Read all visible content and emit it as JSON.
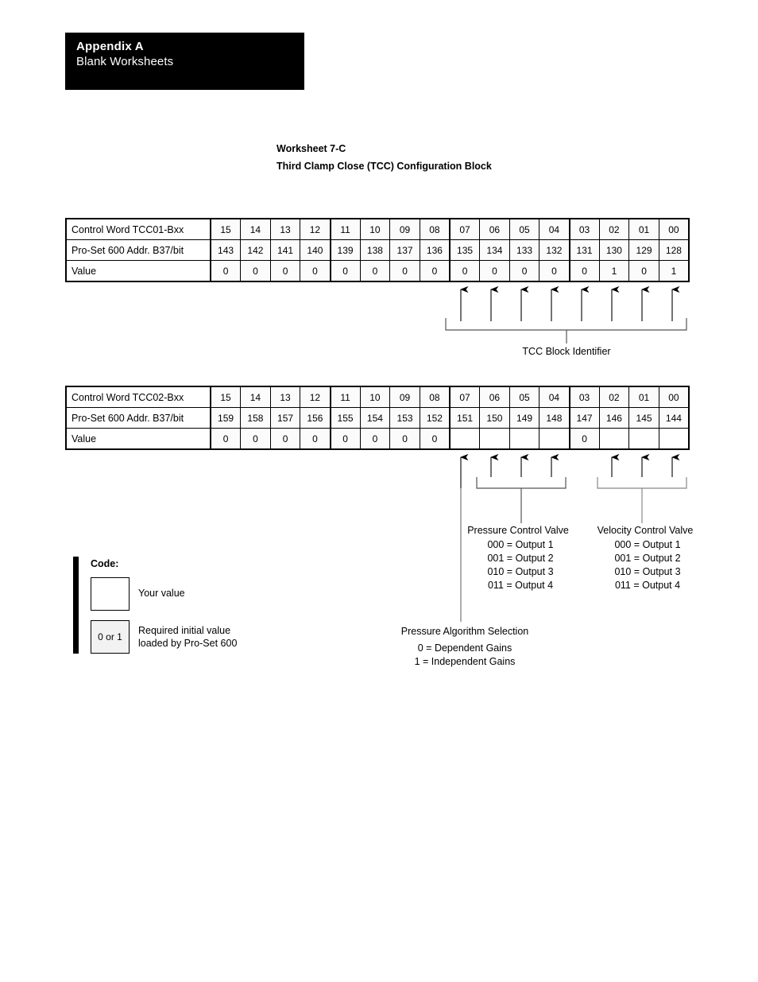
{
  "header": {
    "appendix_title": "Appendix A",
    "appendix_subtitle": "Blank Worksheets"
  },
  "worksheet": {
    "number_label": "Worksheet 7-C",
    "title": "Third Clamp Close (TCC) Configuration Block"
  },
  "tables": [
    {
      "id": "table1",
      "row_labels": {
        "control_word": "Control Word TCC01-Bxx",
        "address": "Pro-Set 600 Addr. B37/bit",
        "value": "Value"
      },
      "bits": [
        "15",
        "14",
        "13",
        "12",
        "11",
        "10",
        "09",
        "08",
        "07",
        "06",
        "05",
        "04",
        "03",
        "02",
        "01",
        "00"
      ],
      "addresses": [
        "143",
        "142",
        "141",
        "140",
        "139",
        "138",
        "137",
        "136",
        "135",
        "134",
        "133",
        "132",
        "131",
        "130",
        "129",
        "128"
      ],
      "values": [
        "0",
        "0",
        "0",
        "0",
        "0",
        "0",
        "0",
        "0",
        "0",
        "0",
        "0",
        "0",
        "0",
        "1",
        "0",
        "1"
      ]
    },
    {
      "id": "table2",
      "row_labels": {
        "control_word": "Control Word TCC02-Bxx",
        "address": "Pro-Set 600 Addr. B37/bit",
        "value": "Value"
      },
      "bits": [
        "15",
        "14",
        "13",
        "12",
        "11",
        "10",
        "09",
        "08",
        "07",
        "06",
        "05",
        "04",
        "03",
        "02",
        "01",
        "00"
      ],
      "addresses": [
        "159",
        "158",
        "157",
        "156",
        "155",
        "154",
        "153",
        "152",
        "151",
        "150",
        "149",
        "148",
        "147",
        "146",
        "145",
        "144"
      ],
      "values": [
        "0",
        "0",
        "0",
        "0",
        "0",
        "0",
        "0",
        "0",
        "",
        "",
        "",
        "",
        "0",
        "",
        "",
        ""
      ]
    }
  ],
  "callouts": {
    "tcc_block_identifier": "TCC Block Identifier",
    "pressure_control_valve": {
      "title": "Pressure Control Valve",
      "options": [
        "000 = Output 1",
        "001 = Output 2",
        "010 = Output 3",
        "011 = Output 4"
      ]
    },
    "velocity_control_valve": {
      "title": "Velocity Control Valve",
      "options": [
        "000 = Output 1",
        "001 = Output 2",
        "010 = Output 3",
        "011 = Output 4"
      ]
    },
    "pressure_algorithm_selection": {
      "title": "Pressure Algorithm Selection",
      "options": [
        "0 = Dependent Gains",
        "1 = Independent Gains"
      ]
    }
  },
  "code_legend": {
    "title": "Code:",
    "your_value_box": "",
    "your_value_desc": "Your value",
    "initial_value_box": "0 or 1",
    "initial_value_desc_line1": "Required initial value",
    "initial_value_desc_line2": "loaded by Pro-Set 600"
  }
}
